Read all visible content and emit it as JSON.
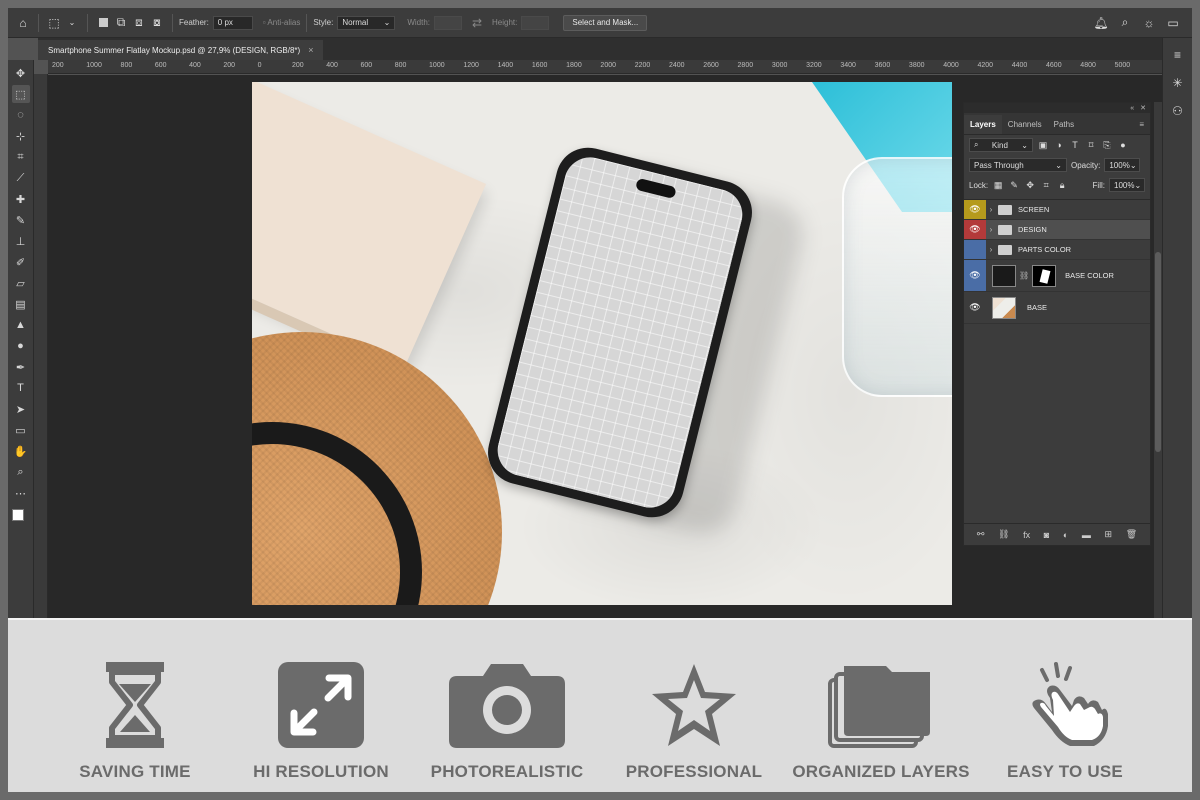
{
  "options_bar": {
    "feather_label": "Feather:",
    "feather_value": "0 px",
    "anti_alias_label": "Anti-alias",
    "style_label": "Style:",
    "style_value": "Normal",
    "width_label": "Width:",
    "height_label": "Height:",
    "select_mask_label": "Select and Mask..."
  },
  "document_tab": {
    "title": "Smartphone Summer Flatlay Mockup.psd @ 27,9% (DESIGN, RGB/8*)",
    "close": "×"
  },
  "ruler_top_ticks": [
    "200",
    "1000",
    "800",
    "600",
    "400",
    "200",
    "0",
    "200",
    "400",
    "600",
    "800",
    "1000",
    "1200",
    "1400",
    "1600",
    "1800",
    "2000",
    "2200",
    "2400",
    "2600",
    "2800",
    "3000",
    "3200",
    "3400",
    "3600",
    "3800",
    "4000",
    "4200",
    "4400",
    "4600",
    "4800",
    "5000"
  ],
  "ruler_top_ticks_visible": [
    "200",
    "1000",
    "800",
    "600",
    "400",
    "200",
    "0",
    "200",
    "400",
    "600",
    "800",
    "1000",
    "1200",
    "1400",
    "1600",
    "1800",
    "2000",
    "2200",
    "2400",
    "2600",
    "2800",
    "3000",
    "3200",
    "3400",
    "3600",
    "3800",
    "4000",
    "4200",
    "4400",
    "4600",
    "4800",
    "5000"
  ],
  "layers_panel": {
    "tabs": [
      "Layers",
      "Channels",
      "Paths"
    ],
    "kind_label": "Kind",
    "blend_mode": "Pass Through",
    "opacity_label": "Opacity:",
    "opacity_value": "100%",
    "lock_label": "Lock:",
    "fill_label": "Fill:",
    "fill_value": "100%",
    "layers": [
      {
        "name": "SCREEN",
        "eye_color": "#b59a1c",
        "type": "group"
      },
      {
        "name": "DESIGN",
        "eye_color": "#b33a3a",
        "type": "group",
        "selected": true
      },
      {
        "name": "PARTS COLOR",
        "eye_color": "#4a6da6",
        "type": "group",
        "hidden": true
      },
      {
        "name": "BASE COLOR",
        "eye_color": "#4a6da6",
        "type": "smart"
      },
      {
        "name": "BASE",
        "eye_color": "#3c3c3c",
        "type": "image"
      }
    ]
  },
  "features": [
    {
      "icon": "hourglass-icon",
      "label": "SAVING TIME"
    },
    {
      "icon": "expand-icon",
      "label": "HI RESOLUTION"
    },
    {
      "icon": "camera-icon",
      "label": "PHOTOREALISTIC"
    },
    {
      "icon": "star-icon",
      "label": "PROFESSIONAL"
    },
    {
      "icon": "layers-icon",
      "label": "ORGANIZED LAYERS"
    },
    {
      "icon": "tap-hand-icon",
      "label": "EASY TO USE"
    }
  ],
  "colors": {
    "feature_gray": "#6b6b6b",
    "panel_bg": "#3c3c3c",
    "pool": "#1eb9d4"
  }
}
